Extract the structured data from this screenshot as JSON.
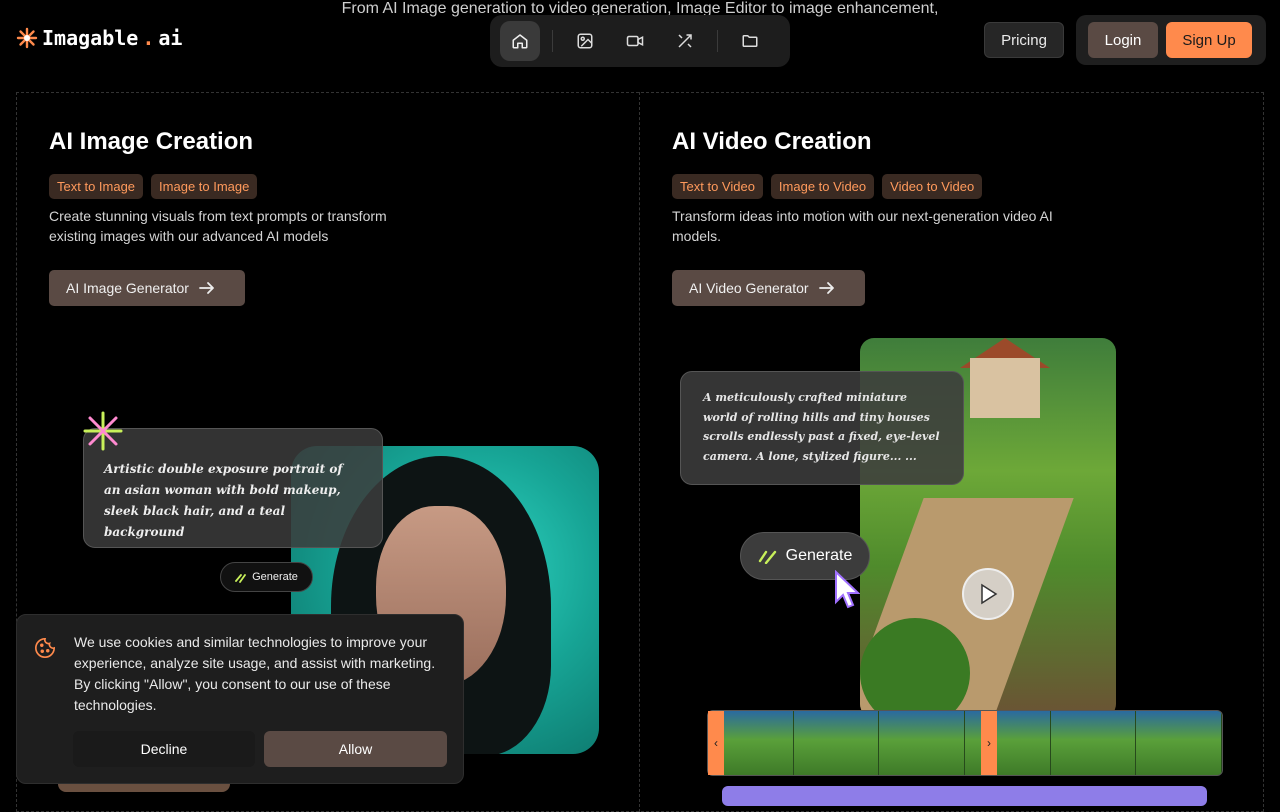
{
  "header": {
    "tagline": "From AI Image generation to video generation, Image Editor to image enhancement,",
    "logo_text": "Imagable",
    "logo_dot": ".",
    "logo_suffix": "ai",
    "nav_icons": [
      "home-icon",
      "image-icon",
      "video-icon",
      "magic-tools-icon",
      "folder-icon"
    ],
    "pricing_label": "Pricing",
    "login_label": "Login",
    "signup_label": "Sign Up"
  },
  "image_section": {
    "title": "AI Image Creation",
    "chips": [
      "Text to Image",
      "Image to Image"
    ],
    "description": "Create stunning visuals from text prompts or transform existing images with our advanced AI models",
    "cta_label": "AI Image Generator",
    "prompt": "Artistic double exposure portrait of an asian woman with bold makeup, sleek black hair, and a teal background",
    "generate_label": "Generate"
  },
  "video_section": {
    "title": "AI Video Creation",
    "chips": [
      "Text to Video",
      "Image to Video",
      "Video to Video"
    ],
    "description": "Transform ideas into motion with our next-generation video AI models.",
    "cta_label": "AI Video Generator",
    "prompt": "A meticulously crafted miniature world of rolling hills and tiny houses scrolls endlessly past a fixed, eye-level camera. A lone, stylized figure... ...",
    "generate_label": "Generate"
  },
  "cookie": {
    "text": "We use cookies and similar technologies to improve your experience, analyze site usage, and assist with marketing. By clicking \"Allow\", you consent to our use of these technologies.",
    "decline_label": "Decline",
    "allow_label": "Allow"
  },
  "colors": {
    "accent": "#ff8a4c",
    "button_brown": "#5a4a44",
    "chip_bg": "#3a2a22",
    "chip_text": "#ff9a5c"
  }
}
